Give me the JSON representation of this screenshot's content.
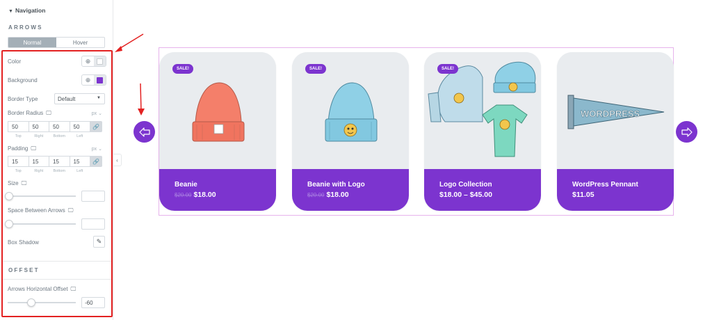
{
  "panel": {
    "section_toggle": "Navigation",
    "arrows_title": "ARROWS",
    "tabs": [
      {
        "label": "Normal",
        "active": true
      },
      {
        "label": "Hover",
        "active": false
      }
    ],
    "color_label": "Color",
    "color_swatch": "#ffffff",
    "background_label": "Background",
    "background_swatch": "#7c34cf",
    "border_type_label": "Border Type",
    "border_type_value": "Default",
    "border_radius_label": "Border Radius",
    "border_radius_unit": "px",
    "border_radius_values": [
      "50",
      "50",
      "50",
      "50"
    ],
    "quad_labels": [
      "Top",
      "Right",
      "Bottom",
      "Left"
    ],
    "padding_label": "Padding",
    "padding_unit": "px",
    "padding_values": [
      "15",
      "15",
      "15",
      "15"
    ],
    "size_label": "Size",
    "size_value": "",
    "space_label": "Space Between Arrows",
    "space_value": "",
    "box_shadow_label": "Box Shadow",
    "offset_title": "OFFSET",
    "h_offset_label": "Arrows Horizontal Offset",
    "h_offset_value": "-60",
    "icons": {
      "globe": "globe-icon",
      "desktop": "desktop-icon",
      "link": "link-icon",
      "edit": "pencil-icon",
      "collapse": "chevron-left-icon"
    }
  },
  "carousel": {
    "accent": "#7c34cf",
    "prev_icon": "arrow-left-icon",
    "next_icon": "arrow-right-icon",
    "products": [
      {
        "name": "Beanie",
        "old_price": "$20.00",
        "price": "$18.00",
        "sale": "SALE!",
        "image": "orange-beanie"
      },
      {
        "name": "Beanie with Logo",
        "old_price": "$20.00",
        "price": "$18.00",
        "sale": "SALE!",
        "image": "blue-beanie-logo"
      },
      {
        "name": "Logo Collection",
        "old_price": "",
        "price": "$18.00 – $45.00",
        "sale": "SALE!",
        "image": "logo-collection"
      },
      {
        "name": "WordPress Pennant",
        "old_price": "",
        "price": "$11.05",
        "sale": "",
        "image": "wordpress-pennant"
      }
    ]
  }
}
